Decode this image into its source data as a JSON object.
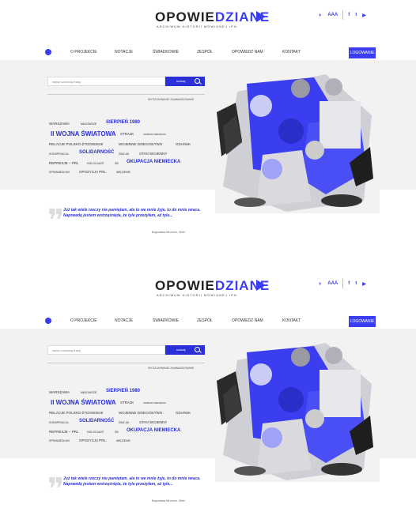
{
  "logo": {
    "part1": "OPOWIE",
    "part2": "DZIANE",
    "subtitle": "ARCHIWUM HISTORII MÓWIONEJ IPN"
  },
  "tools": {
    "contrast": "◑",
    "font_size": "AAA",
    "social": [
      "f",
      "t",
      "▶"
    ]
  },
  "nav": {
    "items": [
      "O PROJEKCIE",
      "NOTACJE",
      "ŚWIADKOWIE",
      "ZESPÓŁ",
      "OPOWIEDZ NAM",
      "KONTAKT"
    ],
    "login": "LOGOWANIE"
  },
  "search": {
    "placeholder": "wpisz szukaną frazę",
    "button": "szukaj",
    "advanced": "WYSZUKIWANIE ZAAWANSOWANE"
  },
  "tags": [
    [
      "WARSZAWA",
      "MAZOWSZE",
      "SIERPIEŃ 1980"
    ],
    [
      "II WOJNA ŚWIATOWA",
      "STRAJK",
      "TERROR NIEMIECKI"
    ],
    [
      "RELACJE POLSKO-ŻYDOWSKIE",
      "WOJENNE DZIECIŃSTWO",
      "GDAŃSK"
    ],
    [
      "KONSPIRACJA",
      "SOLIDARNOŚĆ",
      "ZWZ-AK",
      "STAN WOJENNY"
    ],
    [
      "REPRESJE – PRL",
      "HOLOCAUST",
      "SB",
      "OKUPACJA NIEMIECKA"
    ],
    [
      "SPRAWIEDLIWI",
      "OPOZYCJA PRL",
      "WIĘZIENIE"
    ]
  ],
  "quote": {
    "text": "Już tak wiele rzeczy nie pamiętam, ala to we mnie żyje, to do mnie wraca. Naprawdę jestem wstrząśnięta, że tyle przeżyłam, aż tyle...",
    "author": "Bogusława Wrocheń, Wilet"
  },
  "colors": {
    "accent": "#3a3ef0",
    "dark_accent": "#2b2fd8",
    "hero_bg": "#f2f2f2"
  }
}
